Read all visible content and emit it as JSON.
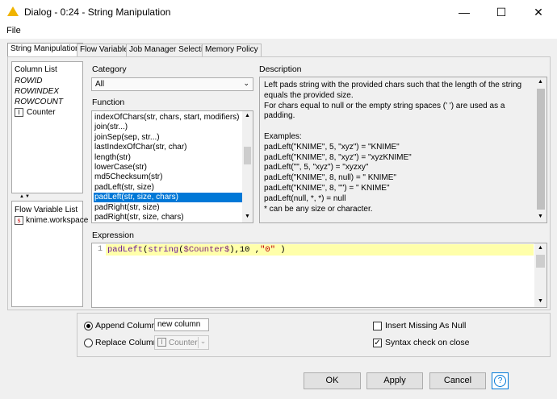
{
  "window": {
    "title": "Dialog - 0:24 - String Manipulation",
    "minimize": "—",
    "maximize": "☐",
    "close": "✕"
  },
  "menu": {
    "file": "File"
  },
  "tabs": [
    "String Manipulation",
    "Flow Variables",
    "Job Manager Selection",
    "Memory Policy"
  ],
  "column_list": {
    "header": "Column List",
    "items": [
      "ROWID",
      "ROWINDEX",
      "ROWCOUNT",
      "Counter"
    ],
    "counter_type": "I"
  },
  "flow_variable_list": {
    "header": "Flow Variable List",
    "items": [
      "knime.workspace"
    ],
    "item_type": "s"
  },
  "category": {
    "label": "Category",
    "value": "All"
  },
  "function": {
    "label": "Function",
    "items": [
      "indexOfChars(str, chars, start, modifiers)",
      "join(str...)",
      "joinSep(sep, str...)",
      "lastIndexOfChar(str, char)",
      "length(str)",
      "lowerCase(str)",
      "md5Checksum(str)",
      "padLeft(str, size)",
      "padLeft(str, size, chars)",
      "padRight(str, size)",
      "padRight(str, size, chars)"
    ],
    "selected_index": 8
  },
  "description": {
    "label": "Description",
    "lines": [
      "Left pads string with the provided chars such that the length of the string",
      "equals the provided size.",
      "For chars equal to null or the empty string spaces (' ') are used as a",
      "padding.",
      "",
      "Examples:",
      "padLeft(\"KNIME\", 5, \"xyz\") = \"KNIME\"",
      "padLeft(\"KNIME\", 8, \"xyz\") = \"xyzKNIME\"",
      "padLeft(\"\", 5, \"xyz\")          = \"xyzxy\"",
      "padLeft(\"KNIME\", 8, null) = \"   KNIME\"",
      "padLeft(\"KNIME\", 8, \"\")     = \"   KNIME\"",
      "padLeft(null, *, *)              = null",
      "* can be any size or character."
    ]
  },
  "expression": {
    "label": "Expression",
    "line_number": "1",
    "code": "padLeft(string($Counter$),10 ,\"0\" )"
  },
  "options": {
    "append_label": "Append Column:",
    "append_value": "new column",
    "replace_label": "Replace Column:",
    "replace_value": "Counter",
    "replace_type": "I",
    "insert_missing_label": "Insert Missing As Null",
    "insert_missing_checked": false,
    "syntax_check_label": "Syntax check on close",
    "syntax_check_checked": true,
    "check_mark": "✓"
  },
  "buttons": {
    "ok": "OK",
    "apply": "Apply",
    "cancel": "Cancel",
    "help": "?"
  }
}
